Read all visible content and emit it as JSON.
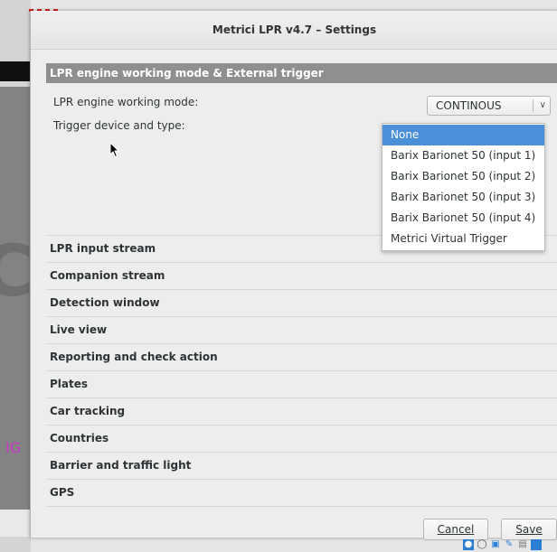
{
  "window": {
    "title": "Metrici LPR v4.7 – Settings"
  },
  "expanded_section": {
    "header": "LPR engine working mode & External trigger",
    "mode_label": "LPR engine working mode:",
    "mode_value": "CONTINOUS",
    "trigger_label": "Trigger device and type:"
  },
  "trigger_dropdown": {
    "selected": "None",
    "options": [
      "None",
      "Barix Barionet 50 (input 1)",
      "Barix Barionet 50 (input 2)",
      "Barix Barionet 50 (input 3)",
      "Barix Barionet 50 (input 4)",
      "Metrici Virtual Trigger"
    ]
  },
  "sections": [
    "LPR input stream",
    "Companion stream",
    "Detection window",
    "Live view",
    "Reporting and check action",
    "Plates",
    "Car tracking",
    "Countries",
    "Barrier and traffic light",
    "GPS"
  ],
  "buttons": {
    "cancel": "Cancel",
    "save": "Save"
  },
  "background": {
    "letter_c": "C",
    "letter_g": "IG"
  }
}
